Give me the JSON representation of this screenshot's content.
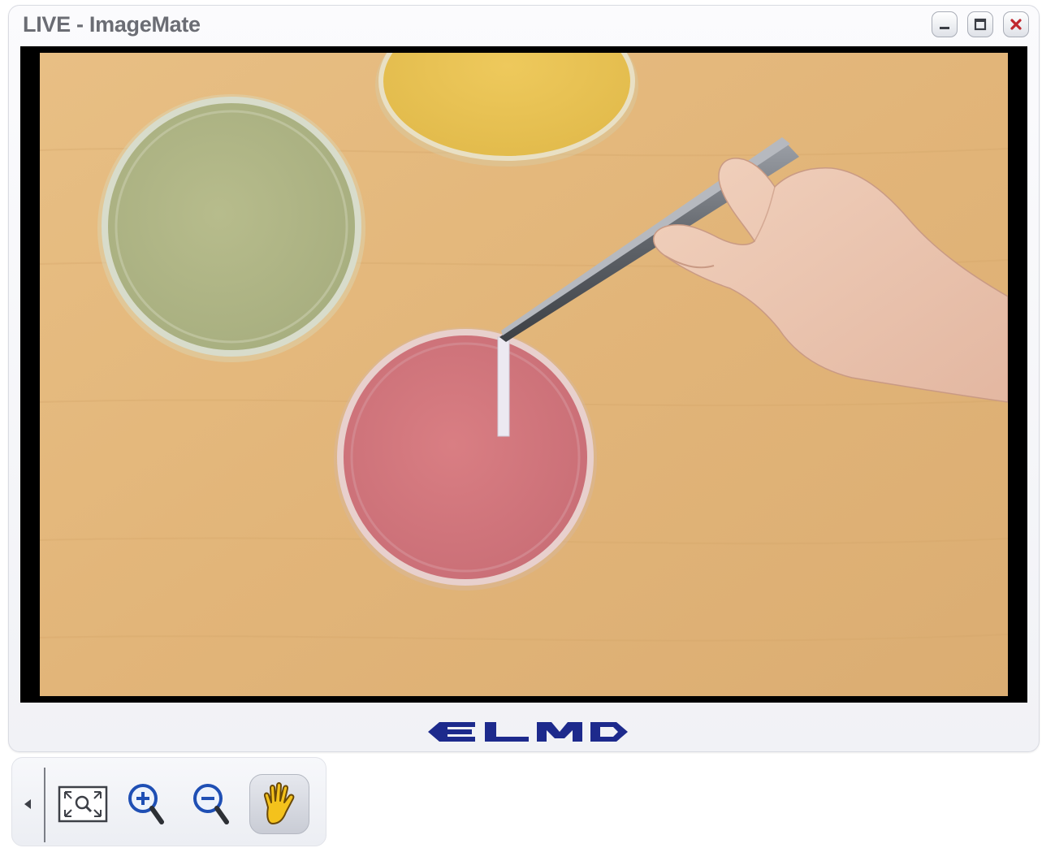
{
  "window": {
    "title": "LIVE - ImageMate",
    "controls": {
      "minimize_icon": "minimize-icon",
      "maximize_icon": "maximize-icon",
      "close_icon": "close-icon",
      "close_color": "#c0272d"
    }
  },
  "viewport": {
    "content": "live camera feed",
    "background": "#000000"
  },
  "footer": {
    "logo_text": "ELMO",
    "logo_color": "#1d2a8c"
  },
  "toolbar": {
    "collapse_icon": "triangle-left-icon",
    "buttons": [
      {
        "name": "fit-to-window",
        "icon": "fit-zoom-icon",
        "active": false
      },
      {
        "name": "zoom-in",
        "icon": "zoom-in-icon",
        "active": false
      },
      {
        "name": "zoom-out",
        "icon": "zoom-out-icon",
        "active": false
      },
      {
        "name": "pan",
        "icon": "hand-icon",
        "active": true
      }
    ]
  },
  "colors": {
    "window_bg": "#f3f4f7",
    "title_text": "#6b6d74",
    "magnifier_blue": "#1f4fb4",
    "hand_yellow": "#f4c21c"
  }
}
